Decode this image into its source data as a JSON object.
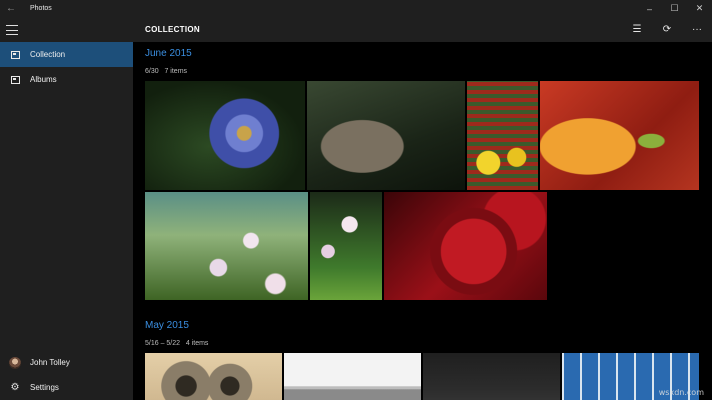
{
  "window": {
    "title": "Photos",
    "back_icon": "back-arrow-icon",
    "controls": {
      "minimize": "–",
      "maximize": "☐",
      "close": "✕"
    }
  },
  "sidebar": {
    "menu_icon": "hamburger-icon",
    "items": [
      {
        "label": "Collection",
        "icon": "collection-icon",
        "selected": true
      },
      {
        "label": "Albums",
        "icon": "albums-icon",
        "selected": false
      }
    ],
    "footer": [
      {
        "label": "John Tolley",
        "icon": "avatar"
      },
      {
        "label": "Settings",
        "icon": "gear-icon"
      }
    ]
  },
  "header": {
    "title": "COLLECTION",
    "actions": [
      {
        "icon": "select-icon",
        "glyph": "☰"
      },
      {
        "icon": "refresh-icon",
        "glyph": "⟳"
      },
      {
        "icon": "more-icon",
        "glyph": "···"
      }
    ]
  },
  "groups": [
    {
      "month": "June 2015",
      "date_range": "6/30",
      "count": "7 items",
      "photos": [
        "thistle",
        "rock-sprouts",
        "sprouts",
        "red-berries",
        "lizard-leaves",
        "meadow-flowers",
        "pink-flowers",
        "pomegranate"
      ]
    },
    {
      "month": "May 2015",
      "date_range": "5/16 – 5/22",
      "count": "4 items",
      "photos": [
        "binocular-viewer",
        "windmills",
        "dark-photo",
        "blue-building"
      ]
    }
  ],
  "watermark": "wsxdn.com",
  "colors": {
    "accent": "#3a8ee0",
    "selected_nav": "#1d4f7a",
    "chrome": "#1f1f1f"
  }
}
